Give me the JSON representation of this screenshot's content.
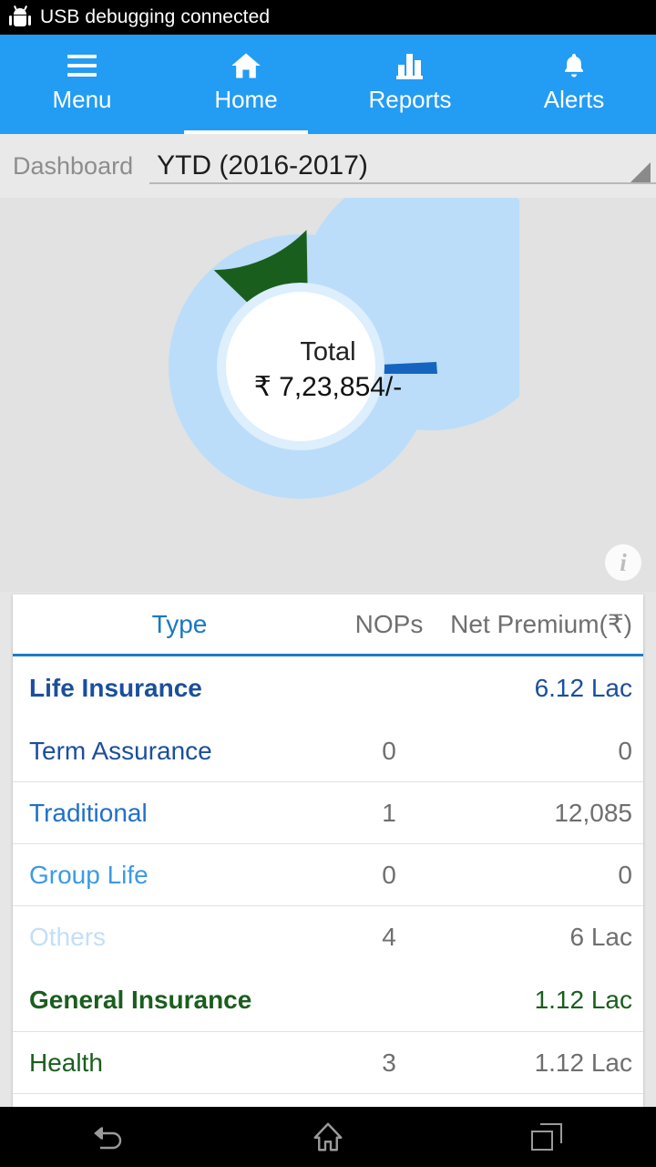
{
  "status_bar": {
    "icon": "android-bugdroid-icon",
    "text": "USB debugging connected"
  },
  "top_tabs": [
    {
      "label": "Menu",
      "icon": "hamburger-menu-icon",
      "active": false
    },
    {
      "label": "Home",
      "icon": "home-icon",
      "active": true
    },
    {
      "label": "Reports",
      "icon": "bar-chart-icon",
      "active": false
    },
    {
      "label": "Alerts",
      "icon": "bell-icon",
      "active": false
    }
  ],
  "filter_bar": {
    "label": "Dashboard",
    "selected_period": "YTD (2016-2017)",
    "caret_icon": "spinner-caret-icon"
  },
  "chart_panel": {
    "center_title": "Total",
    "center_value": "₹ 7,23,854/-",
    "info_icon": "info-icon"
  },
  "chart_data": {
    "type": "pie",
    "title": "Total",
    "subtitle": "₹ 7,23,854/-",
    "legend": "none",
    "total": 723854,
    "total_display": "₹ 7,23,854/-",
    "labels": [
      "Life Insurance",
      "General Insurance",
      "Others"
    ],
    "values": [
      612000,
      112000,
      5000
    ],
    "percent": [
      84.0,
      15.4,
      0.6
    ],
    "colors": [
      "#bbddf9",
      "#1a5e1e",
      "#1565c0"
    ],
    "exploded": [
      "General Insurance"
    ],
    "inner_radius_ratio": 0.55
  },
  "table": {
    "headers": {
      "type": "Type",
      "nops": "NOPs",
      "premium": "Net Premium(₹)"
    },
    "rows": [
      {
        "type": "Life Insurance",
        "nops": "",
        "premium": "6.12 Lac",
        "style": "group-blue"
      },
      {
        "type": "Term Assurance",
        "nops": "0",
        "premium": "0",
        "style": "blue-1"
      },
      {
        "type": "Traditional",
        "nops": "1",
        "premium": "12,085",
        "style": "blue-2"
      },
      {
        "type": "Group Life",
        "nops": "0",
        "premium": "0",
        "style": "blue-3"
      },
      {
        "type": "Others",
        "nops": "4",
        "premium": "6 Lac",
        "style": "blue-4"
      },
      {
        "type": "General Insurance",
        "nops": "",
        "premium": "1.12 Lac",
        "style": "group-green"
      },
      {
        "type": "Health",
        "nops": "3",
        "premium": "1.12 Lac",
        "style": "green-1"
      }
    ]
  },
  "system_nav": [
    {
      "name": "back",
      "icon": "back-arrow-icon"
    },
    {
      "name": "home",
      "icon": "home-outline-icon"
    },
    {
      "name": "recent",
      "icon": "recent-apps-icon"
    }
  ],
  "colors": {
    "accent_blue": "#239cf3",
    "header_blue": "#1a78c2",
    "group_blue": "#1b4f9c",
    "group_green": "#1a5e1e",
    "light_blue": "#bbddf9",
    "value_grey": "#6f6f6f"
  }
}
